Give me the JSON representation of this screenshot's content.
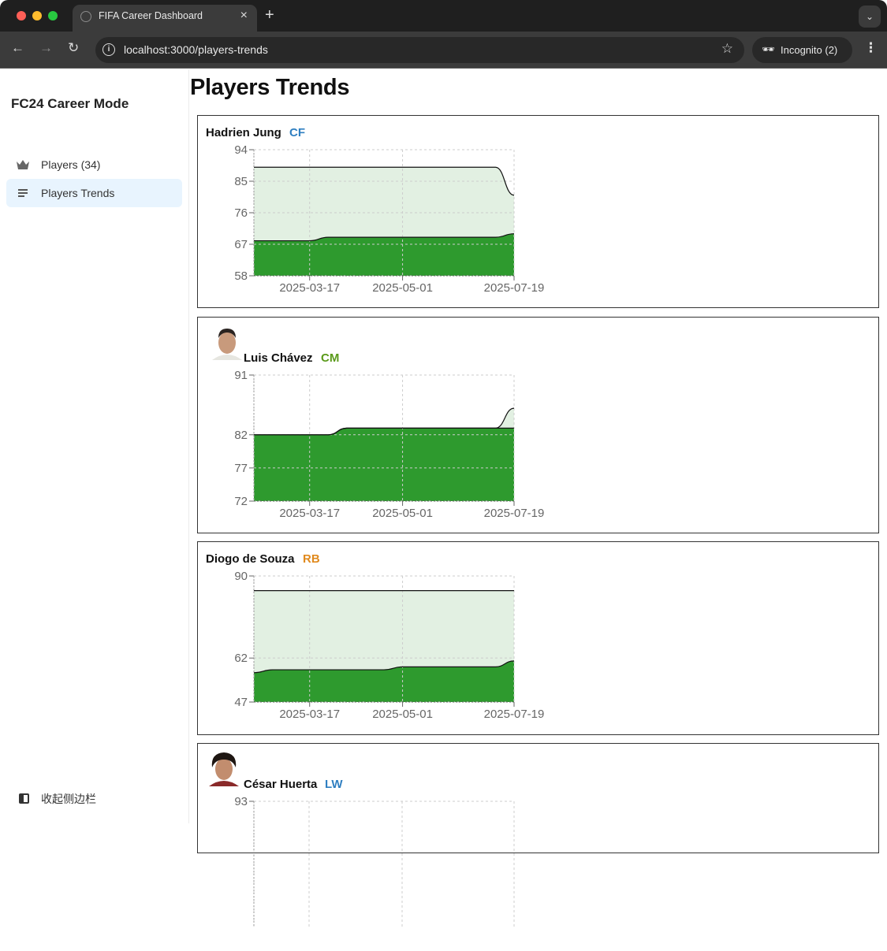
{
  "browser": {
    "tab_title": "FIFA Career Dashboard",
    "url": "localhost:3000/players-trends",
    "profile_label": "Incognito (2)",
    "icons": {
      "back": "arrow-left-icon",
      "forward": "arrow-right-icon",
      "reload": "reload-icon",
      "info": "info-icon",
      "bookmark": "star-icon",
      "incognito": "incognito-icon",
      "menu": "kebab-menu-icon",
      "tab_close": "close-icon",
      "new_tab": "plus-icon",
      "tab_search": "chevron-down-icon"
    }
  },
  "sidebar": {
    "brand": "FC24 Career Mode",
    "items": [
      {
        "label": "Players (34)",
        "icon": "crown-icon",
        "active": false
      },
      {
        "label": "Players Trends",
        "icon": "list-icon",
        "active": true
      }
    ],
    "collapse_label": "收起侧边栏",
    "collapse_icon": "sidebar-toggle-icon"
  },
  "main": {
    "title": "Players Trends"
  },
  "colors": {
    "overall_fill": "#2e9a2e",
    "potential_fill": "#e2f0e2",
    "line": "#111111",
    "grid": "#cccccc",
    "pos_CF": "#2f7fc1",
    "pos_CM": "#5a9a1a",
    "pos_RB": "#e08a1e",
    "pos_LW": "#2f7fc1"
  },
  "chart_data": [
    {
      "type": "area",
      "player": "Hadrien Jung",
      "position": "CF",
      "has_avatar": false,
      "x": [
        "p0",
        "p1",
        "p2",
        "2025-03-17",
        "p4",
        "p5",
        "p6",
        "p7",
        "2025-05-01",
        "p9",
        "p10",
        "p11",
        "p12",
        "p13",
        "2025-07-19"
      ],
      "xticks": [
        "2025-03-17",
        "2025-05-01",
        "2025-07-19"
      ],
      "yticks": [
        58,
        67,
        76,
        85,
        94
      ],
      "ylim": [
        58,
        94
      ],
      "grid": true,
      "series": [
        {
          "name": "potential",
          "values": [
            89,
            89,
            89,
            89,
            89,
            89,
            89,
            89,
            89,
            89,
            89,
            89,
            89,
            89,
            81
          ]
        },
        {
          "name": "overall",
          "values": [
            68,
            68,
            68,
            68,
            69,
            69,
            69,
            69,
            69,
            69,
            69,
            69,
            69,
            69,
            70
          ]
        }
      ]
    },
    {
      "type": "area",
      "player": "Luis Chávez",
      "position": "CM",
      "has_avatar": true,
      "x": [
        "p0",
        "p1",
        "p2",
        "2025-03-17",
        "p4",
        "p5",
        "p6",
        "p7",
        "2025-05-01",
        "p9",
        "p10",
        "p11",
        "p12",
        "p13",
        "2025-07-19"
      ],
      "xticks": [
        "2025-03-17",
        "2025-05-01",
        "2025-07-19"
      ],
      "yticks": [
        72,
        77,
        82,
        91
      ],
      "ylim": [
        72,
        91
      ],
      "grid": true,
      "series": [
        {
          "name": "potential",
          "values": [
            82,
            82,
            82,
            82,
            82,
            83,
            83,
            83,
            83,
            83,
            83,
            83,
            83,
            83,
            86
          ]
        },
        {
          "name": "overall",
          "values": [
            82,
            82,
            82,
            82,
            82,
            83,
            83,
            83,
            83,
            83,
            83,
            83,
            83,
            83,
            83
          ]
        }
      ]
    },
    {
      "type": "area",
      "player": "Diogo de Souza",
      "position": "RB",
      "has_avatar": false,
      "x": [
        "p0",
        "p1",
        "p2",
        "2025-03-17",
        "p4",
        "p5",
        "p6",
        "p7",
        "2025-05-01",
        "p9",
        "p10",
        "p11",
        "p12",
        "p13",
        "2025-07-19"
      ],
      "xticks": [
        "2025-03-17",
        "2025-05-01",
        "2025-07-19"
      ],
      "yticks": [
        47,
        62,
        90
      ],
      "ylim": [
        47,
        90
      ],
      "grid": true,
      "series": [
        {
          "name": "potential",
          "values": [
            85,
            85,
            85,
            85,
            85,
            85,
            85,
            85,
            85,
            85,
            85,
            85,
            85,
            85,
            85
          ]
        },
        {
          "name": "overall",
          "values": [
            57,
            58,
            58,
            58,
            58,
            58,
            58,
            58,
            59,
            59,
            59,
            59,
            59,
            59,
            61
          ]
        }
      ]
    },
    {
      "type": "area",
      "player": "César Huerta",
      "position": "LW",
      "has_avatar": true,
      "xticks": [],
      "yticks": [
        93
      ],
      "ylim": [
        null,
        93
      ],
      "grid": true,
      "series": []
    }
  ]
}
